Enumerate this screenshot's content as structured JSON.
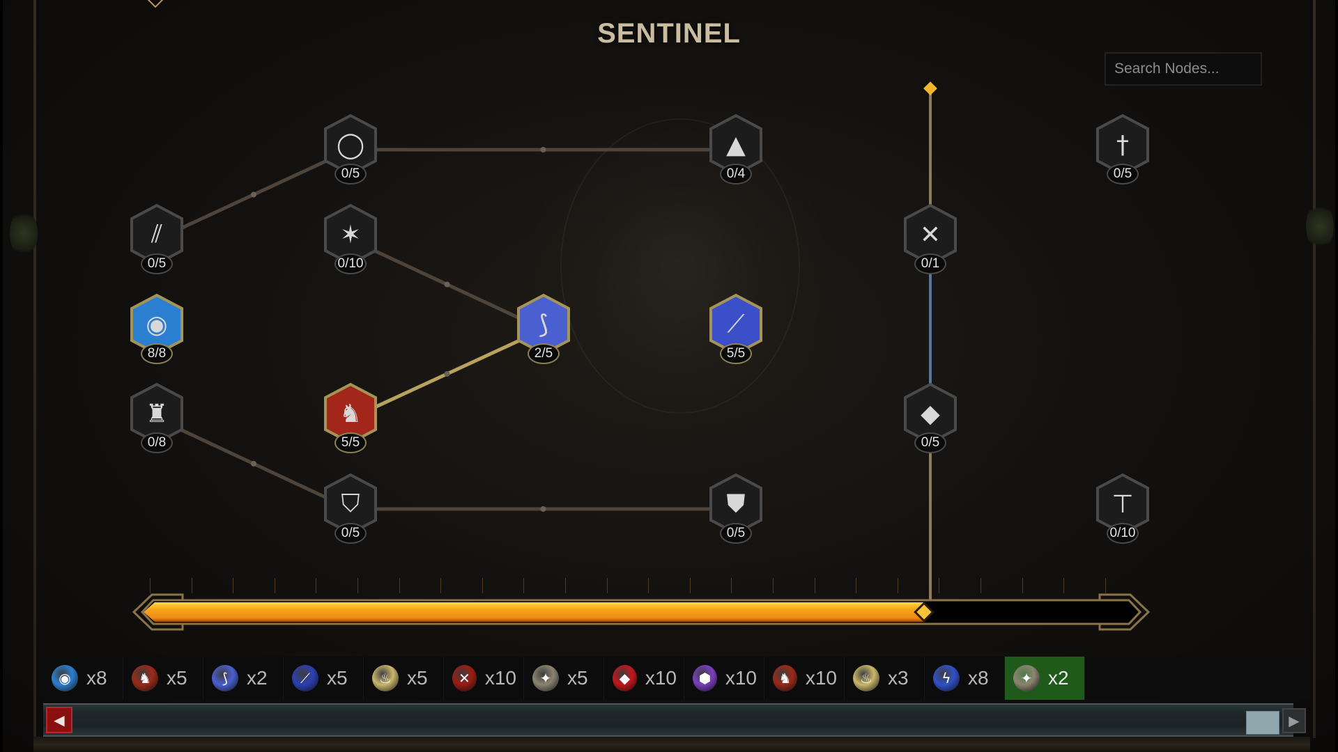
{
  "window": {
    "title": "SENTINEL"
  },
  "search": {
    "placeholder": "Search Nodes...",
    "value": ""
  },
  "progress": {
    "fraction": 0.79,
    "fill_color": "#f2a21c",
    "marker": "gold-diamond"
  },
  "colors": {
    "gold": "#c7a24a",
    "allocated_border": "#a59458",
    "unallocated_border": "#4a4a4a",
    "connector": "#4e443a",
    "connector_active": "#b9a25e",
    "blue_line": "#5b72a0",
    "selected_item": "#1f5a1b"
  },
  "nodes": [
    {
      "id": "n1",
      "icon": "black-ring",
      "glyph": "◯",
      "points": "0/5",
      "allocated": false,
      "col": 1,
      "row": 0
    },
    {
      "id": "n2",
      "icon": "hooded-cloak",
      "glyph": "▲",
      "points": "0/4",
      "allocated": false,
      "col": 3,
      "row": 0
    },
    {
      "id": "n3",
      "icon": "sword-in-ground",
      "glyph": "†",
      "points": "0/5",
      "allocated": false,
      "col": 5,
      "row": 0
    },
    {
      "id": "n4",
      "icon": "shattered-blades",
      "glyph": "⫽",
      "points": "0/5",
      "allocated": false,
      "col": 0,
      "row": 1
    },
    {
      "id": "n5",
      "icon": "light-slash",
      "glyph": "✶",
      "points": "0/10",
      "allocated": false,
      "col": 1,
      "row": 1
    },
    {
      "id": "n6",
      "icon": "crossed-swords",
      "glyph": "✕",
      "points": "0/1",
      "allocated": false,
      "col": 4,
      "row": 1
    },
    {
      "id": "n7",
      "icon": "blue-shield-orb",
      "glyph": "◉",
      "points": "8/8",
      "allocated": true,
      "col": 0,
      "row": 2,
      "tint": "#2b7fd0"
    },
    {
      "id": "n8",
      "icon": "arcane-blade",
      "glyph": "⟆",
      "points": "2/5",
      "allocated": true,
      "col": 2,
      "row": 2,
      "tint": "#4a5fd0"
    },
    {
      "id": "n9",
      "icon": "fiery-sword-slash",
      "glyph": "⟋",
      "points": "5/5",
      "allocated": true,
      "col": 3,
      "row": 2,
      "tint": "#3b4fc8"
    },
    {
      "id": "n10",
      "icon": "chestplate",
      "glyph": "♜",
      "points": "0/8",
      "allocated": false,
      "col": 0,
      "row": 3
    },
    {
      "id": "n11",
      "icon": "flame-warrior",
      "glyph": "♞",
      "points": "5/5",
      "allocated": true,
      "col": 1,
      "row": 3,
      "tint": "#a3261a"
    },
    {
      "id": "n12",
      "icon": "gauntlet",
      "glyph": "◆",
      "points": "0/5",
      "allocated": false,
      "col": 4,
      "row": 3
    },
    {
      "id": "n13",
      "icon": "kite-shield",
      "glyph": "⛉",
      "points": "0/5",
      "allocated": false,
      "col": 1,
      "row": 4
    },
    {
      "id": "n14",
      "icon": "split-shield",
      "glyph": "⛊",
      "points": "0/5",
      "allocated": false,
      "col": 3,
      "row": 4
    },
    {
      "id": "n15",
      "icon": "hammer",
      "glyph": "⊤",
      "points": "0/10",
      "allocated": false,
      "col": 5,
      "row": 4
    }
  ],
  "items": [
    {
      "icon": "blue-shield-orb",
      "qty": "x8",
      "color": "#2b7fd0",
      "glyph": "◉"
    },
    {
      "icon": "flame-warrior",
      "qty": "x5",
      "color": "#9a2a1a",
      "glyph": "♞"
    },
    {
      "icon": "arcane-blade",
      "qty": "x2",
      "color": "#4a5fd0",
      "glyph": "⟆"
    },
    {
      "icon": "fiery-sword-slash",
      "qty": "x5",
      "color": "#2c3fb4",
      "glyph": "⟋"
    },
    {
      "icon": "golden-brazier",
      "qty": "x5",
      "color": "#c9b76a",
      "glyph": "♨"
    },
    {
      "icon": "crossed-red-blades",
      "qty": "x10",
      "color": "#9b1c12",
      "glyph": "✕"
    },
    {
      "icon": "holy-warrior",
      "qty": "x5",
      "color": "#8c8470",
      "glyph": "✦"
    },
    {
      "icon": "red-crystal",
      "qty": "x10",
      "color": "#c4161a",
      "glyph": "◆"
    },
    {
      "icon": "purple-gem",
      "qty": "x10",
      "color": "#7a3fc0",
      "glyph": "⬢"
    },
    {
      "icon": "flame-warrior",
      "qty": "x10",
      "color": "#9a2a1a",
      "glyph": "♞"
    },
    {
      "icon": "golden-brazier",
      "qty": "x3",
      "color": "#c9b76a",
      "glyph": "♨"
    },
    {
      "icon": "blue-lightning",
      "qty": "x8",
      "color": "#3150c8",
      "glyph": "ϟ"
    },
    {
      "icon": "holy-warrior",
      "qty": "x2",
      "color": "#8c8470",
      "glyph": "✦",
      "selected": true
    }
  ],
  "scroll": {
    "left_icon": "◀",
    "right_icon": "▶"
  }
}
